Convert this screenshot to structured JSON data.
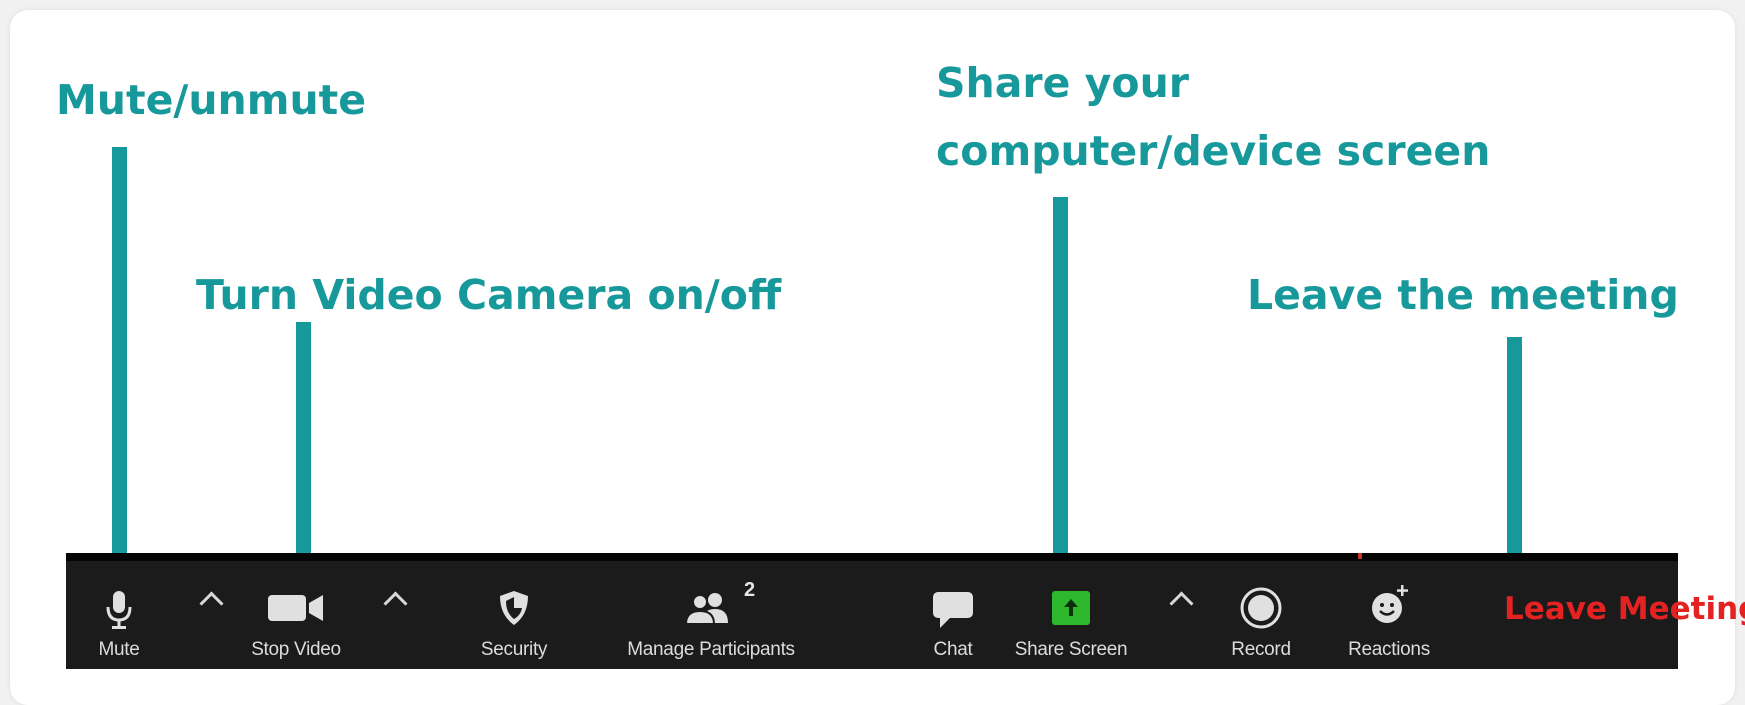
{
  "callouts": {
    "mute": "Mute/unmute",
    "video": "Turn Video Camera on/off",
    "share_line1": "Share your",
    "share_line2": "computer/device screen",
    "leave": "Leave the meeting"
  },
  "toolbar": {
    "mute_label": "Mute",
    "stop_video_label": "Stop Video",
    "security_label": "Security",
    "participants_label": "Manage Participants",
    "participants_count": "2",
    "chat_label": "Chat",
    "share_screen_label": "Share Screen",
    "record_label": "Record",
    "reactions_label": "Reactions",
    "leave_label": "Leave Meeting"
  },
  "icons": [
    "microphone-icon",
    "caret-up-icon",
    "video-camera-icon",
    "shield-icon",
    "participants-icon",
    "chat-icon",
    "share-screen-icon",
    "record-icon",
    "reactions-icon"
  ],
  "colors": {
    "callout": "#17999b",
    "toolbar_bg": "#1b1b1b",
    "share_green": "#2eb82e",
    "leave_red": "#e52222"
  }
}
